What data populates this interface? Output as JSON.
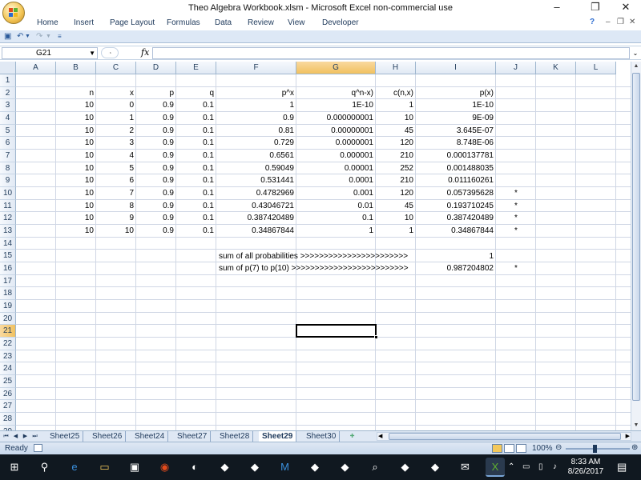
{
  "window": {
    "title": "Theo Algebra Workbook.xlsm - Microsoft Excel non-commercial use",
    "minimize": "–",
    "restore": "❐",
    "close": "✕"
  },
  "ribbon": {
    "tabs": [
      "Home",
      "Insert",
      "Page Layout",
      "Formulas",
      "Data",
      "Review",
      "View",
      "Developer"
    ],
    "help": "?",
    "min": "–",
    "restore": "❐",
    "close": "✕"
  },
  "formula_bar": {
    "name_box": "G21",
    "fx": "fx",
    "formula": ""
  },
  "columns": [
    "A",
    "B",
    "C",
    "D",
    "E",
    "F",
    "G",
    "H",
    "I",
    "J",
    "K",
    "L"
  ],
  "selected_column": "G",
  "rows": [
    "1",
    "2",
    "3",
    "4",
    "5",
    "6",
    "7",
    "8",
    "9",
    "10",
    "11",
    "12",
    "13",
    "14",
    "15",
    "16",
    "17",
    "18",
    "19",
    "20",
    "21",
    "22",
    "23",
    "24",
    "25",
    "26",
    "27",
    "28",
    "29"
  ],
  "selected_row": "21",
  "headers": {
    "B": "n",
    "C": "x",
    "D": "p",
    "E": "q",
    "F": "p^x",
    "G": "q^n-x)",
    "H": "c(n,x)",
    "I": "p(x)"
  },
  "table": [
    {
      "n": "10",
      "x": "0",
      "p": "0.9",
      "q": "0.1",
      "px": "1",
      "qnx": "1E-10",
      "cnx": "1",
      "prob": "1E-10",
      "mark": ""
    },
    {
      "n": "10",
      "x": "1",
      "p": "0.9",
      "q": "0.1",
      "px": "0.9",
      "qnx": "0.000000001",
      "cnx": "10",
      "prob": "9E-09",
      "mark": ""
    },
    {
      "n": "10",
      "x": "2",
      "p": "0.9",
      "q": "0.1",
      "px": "0.81",
      "qnx": "0.00000001",
      "cnx": "45",
      "prob": "3.645E-07",
      "mark": ""
    },
    {
      "n": "10",
      "x": "3",
      "p": "0.9",
      "q": "0.1",
      "px": "0.729",
      "qnx": "0.0000001",
      "cnx": "120",
      "prob": "8.748E-06",
      "mark": ""
    },
    {
      "n": "10",
      "x": "4",
      "p": "0.9",
      "q": "0.1",
      "px": "0.6561",
      "qnx": "0.000001",
      "cnx": "210",
      "prob": "0.000137781",
      "mark": ""
    },
    {
      "n": "10",
      "x": "5",
      "p": "0.9",
      "q": "0.1",
      "px": "0.59049",
      "qnx": "0.00001",
      "cnx": "252",
      "prob": "0.001488035",
      "mark": ""
    },
    {
      "n": "10",
      "x": "6",
      "p": "0.9",
      "q": "0.1",
      "px": "0.531441",
      "qnx": "0.0001",
      "cnx": "210",
      "prob": "0.011160261",
      "mark": ""
    },
    {
      "n": "10",
      "x": "7",
      "p": "0.9",
      "q": "0.1",
      "px": "0.4782969",
      "qnx": "0.001",
      "cnx": "120",
      "prob": "0.057395628",
      "mark": "*"
    },
    {
      "n": "10",
      "x": "8",
      "p": "0.9",
      "q": "0.1",
      "px": "0.43046721",
      "qnx": "0.01",
      "cnx": "45",
      "prob": "0.193710245",
      "mark": "*"
    },
    {
      "n": "10",
      "x": "9",
      "p": "0.9",
      "q": "0.1",
      "px": "0.387420489",
      "qnx": "0.1",
      "cnx": "10",
      "prob": "0.387420489",
      "mark": "*"
    },
    {
      "n": "10",
      "x": "10",
      "p": "0.9",
      "q": "0.1",
      "px": "0.34867844",
      "qnx": "1",
      "cnx": "1",
      "prob": "0.34867844",
      "mark": "*"
    }
  ],
  "summary": [
    {
      "label": "sum of all probabilities >>>>>>>>>>>>>>>>>>>>>>>",
      "value": "1",
      "mark": ""
    },
    {
      "label": "sum of p(7) to p(10) >>>>>>>>>>>>>>>>>>>>>>>>>",
      "value": "0.987204802",
      "mark": "*"
    }
  ],
  "sheets": [
    "Sheet25",
    "Sheet26",
    "Sheet24",
    "Sheet27",
    "Sheet28",
    "Sheet29",
    "Sheet30"
  ],
  "active_sheet": "Sheet29",
  "status": {
    "ready": "Ready",
    "zoom": "100%"
  },
  "taskbar": {
    "time": "8:33 AM",
    "date": "8/26/2017",
    "icons": [
      "windows-icon",
      "search-icon",
      "edge-icon",
      "file-explorer-icon",
      "store-icon",
      "chrome-icon",
      "firefox-icon",
      "app-icon",
      "app-icon",
      "malwarebytes-icon",
      "app-icon",
      "app-icon",
      "magnifier-icon",
      "app-icon",
      "app-icon",
      "mail-icon",
      "excel-icon"
    ]
  }
}
